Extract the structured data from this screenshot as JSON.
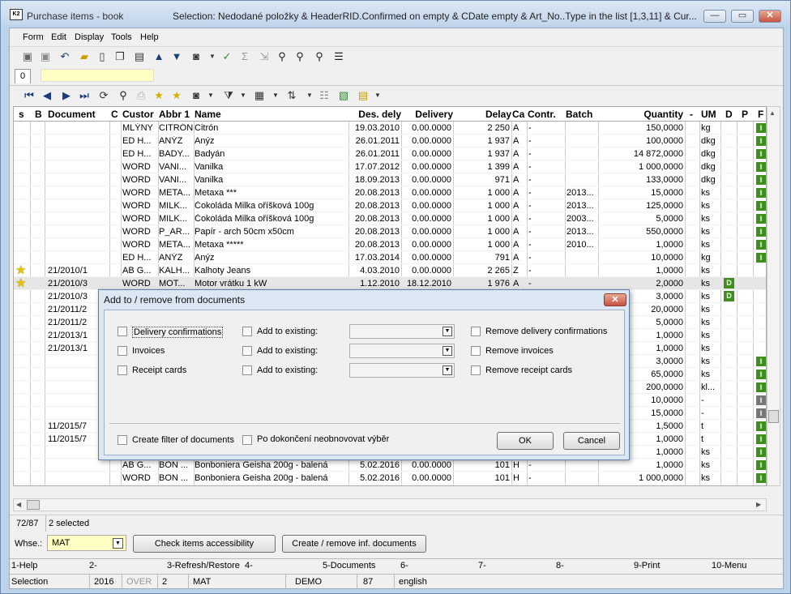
{
  "window": {
    "title": "Purchase items - book",
    "selection": "Selection: Nedodané položky & HeaderRID.Confirmed on empty  & CDate empty  & Art_No..Type in the list [1,3,11] & Cur..."
  },
  "menu": [
    "Form",
    "Edit",
    "Display",
    "Tools",
    "Help"
  ],
  "tab": {
    "label": "0"
  },
  "columns": [
    "s",
    "B",
    "Document",
    "C",
    "Custor",
    "Abbr 1",
    "Name",
    "Des. dely",
    "Delivery",
    "Delay",
    "Ca",
    "Contr.",
    "Batch",
    "Quantity",
    "-",
    "UM",
    "D",
    "P",
    "F"
  ],
  "rows": [
    {
      "star": false,
      "document": "",
      "custor": "MLÝNY",
      "abbr": "CITRÓN",
      "name": "Citrón",
      "des": "19.03.2010",
      "delivery": "0.00.0000",
      "delay": "2 250",
      "ca": "A",
      "contr": "-",
      "batch": "",
      "qty": "150,0000",
      "um": "kg",
      "d": "",
      "f": "I",
      "fgray": false
    },
    {
      "star": false,
      "document": "",
      "custor": "ED H...",
      "abbr": "ANÝZ",
      "name": "Anýz",
      "des": "26.01.2011",
      "delivery": "0.00.0000",
      "delay": "1 937",
      "ca": "A",
      "contr": "-",
      "batch": "",
      "qty": "100,0000",
      "um": "dkg",
      "d": "",
      "f": "I",
      "fgray": false
    },
    {
      "star": false,
      "document": "",
      "custor": "ED H...",
      "abbr": "BADY...",
      "name": "Badyán",
      "des": "26.01.2011",
      "delivery": "0.00.0000",
      "delay": "1 937",
      "ca": "A",
      "contr": "-",
      "batch": "",
      "qty": "14 872,0000",
      "um": "dkg",
      "d": "",
      "f": "I",
      "fgray": false
    },
    {
      "star": false,
      "document": "",
      "custor": "WORD",
      "abbr": "VANI...",
      "name": "Vanilka",
      "des": "17.07.2012",
      "delivery": "0.00.0000",
      "delay": "1 399",
      "ca": "A",
      "contr": "-",
      "batch": "",
      "qty": "1 000,0000",
      "um": "dkg",
      "d": "",
      "f": "I",
      "fgray": false
    },
    {
      "star": false,
      "document": "",
      "custor": "WORD",
      "abbr": "VANI...",
      "name": "Vanilka",
      "des": "18.09.2013",
      "delivery": "0.00.0000",
      "delay": "971",
      "ca": "A",
      "contr": "-",
      "batch": "",
      "qty": "133,0000",
      "um": "dkg",
      "d": "",
      "f": "I",
      "fgray": false
    },
    {
      "star": false,
      "document": "",
      "custor": "WORD",
      "abbr": "META...",
      "name": "Metaxa ***",
      "des": "20.08.2013",
      "delivery": "0.00.0000",
      "delay": "1 000",
      "ca": "A",
      "contr": "-",
      "batch": "2013...",
      "qty": "15,0000",
      "um": "ks",
      "d": "",
      "f": "I",
      "fgray": false
    },
    {
      "star": false,
      "document": "",
      "custor": "WORD",
      "abbr": "MILK...",
      "name": "Čokoláda Milka oříšková 100g",
      "des": "20.08.2013",
      "delivery": "0.00.0000",
      "delay": "1 000",
      "ca": "A",
      "contr": "-",
      "batch": "2013...",
      "qty": "125,0000",
      "um": "ks",
      "d": "",
      "f": "I",
      "fgray": false
    },
    {
      "star": false,
      "document": "",
      "custor": "WORD",
      "abbr": "MILK...",
      "name": "Čokoláda Milka oříšková 100g",
      "des": "20.08.2013",
      "delivery": "0.00.0000",
      "delay": "1 000",
      "ca": "A",
      "contr": "-",
      "batch": "2003...",
      "qty": "5,0000",
      "um": "ks",
      "d": "",
      "f": "I",
      "fgray": false
    },
    {
      "star": false,
      "document": "",
      "custor": "WORD",
      "abbr": "P_AR...",
      "name": "Papír - arch 50cm x50cm",
      "des": "20.08.2013",
      "delivery": "0.00.0000",
      "delay": "1 000",
      "ca": "A",
      "contr": "-",
      "batch": "2013...",
      "qty": "550,0000",
      "um": "ks",
      "d": "",
      "f": "I",
      "fgray": false
    },
    {
      "star": false,
      "document": "",
      "custor": "WORD",
      "abbr": "META...",
      "name": "Metaxa *****",
      "des": "20.08.2013",
      "delivery": "0.00.0000",
      "delay": "1 000",
      "ca": "A",
      "contr": "-",
      "batch": "2010...",
      "qty": "1,0000",
      "um": "ks",
      "d": "",
      "f": "I",
      "fgray": false
    },
    {
      "star": false,
      "document": "",
      "custor": "ED H...",
      "abbr": "ANÝZ",
      "name": "Anýz",
      "des": "17.03.2014",
      "delivery": "0.00.0000",
      "delay": "791",
      "ca": "A",
      "contr": "-",
      "batch": "",
      "qty": "10,0000",
      "um": "kg",
      "d": "",
      "f": "I",
      "fgray": false
    },
    {
      "star": true,
      "document": "21/2010/1",
      "custor": "AB G...",
      "abbr": "KALH...",
      "name": "Kalhoty Jeans",
      "des": "4.03.2010",
      "delivery": "0.00.0000",
      "delay": "2 265",
      "ca": "Z",
      "contr": "-",
      "batch": "",
      "qty": "1,0000",
      "um": "ks",
      "d": "",
      "f": "",
      "fgray": false
    },
    {
      "star": true,
      "document": "21/2010/3",
      "custor": "WORD",
      "abbr": "MOT...",
      "name": "Motor vrátku 1 kW",
      "des": "1.12.2010",
      "delivery": "18.12.2010",
      "delay": "1 976",
      "ca": "A",
      "contr": "-",
      "batch": "",
      "qty": "2,0000",
      "um": "ks",
      "d": "D",
      "f": "",
      "fgray": false,
      "sel": true
    },
    {
      "star": false,
      "document": "21/2010/3",
      "custor": "",
      "abbr": "",
      "name": "",
      "des": "",
      "delivery": "",
      "delay": "",
      "ca": "",
      "contr": "",
      "batch": "",
      "qty": "3,0000",
      "um": "ks",
      "d": "D",
      "f": "",
      "fgray": false
    },
    {
      "star": false,
      "document": "21/2011/2",
      "custor": "",
      "abbr": "",
      "name": "",
      "des": "",
      "delivery": "",
      "delay": "",
      "ca": "",
      "contr": "",
      "batch": "",
      "qty": "20,0000",
      "um": "ks",
      "d": "",
      "f": "",
      "fgray": false
    },
    {
      "star": false,
      "document": "21/2011/2",
      "custor": "",
      "abbr": "",
      "name": "",
      "des": "",
      "delivery": "",
      "delay": "",
      "ca": "",
      "contr": "",
      "batch": "",
      "qty": "5,0000",
      "um": "ks",
      "d": "",
      "f": "",
      "fgray": false
    },
    {
      "star": false,
      "document": "21/2013/1",
      "custor": "",
      "abbr": "",
      "name": "",
      "des": "",
      "delivery": "",
      "delay": "",
      "ca": "",
      "contr": "",
      "batch": "",
      "qty": "1,0000",
      "um": "ks",
      "d": "",
      "f": "",
      "fgray": false
    },
    {
      "star": false,
      "document": "21/2013/1",
      "custor": "",
      "abbr": "",
      "name": "",
      "des": "",
      "delivery": "",
      "delay": "",
      "ca": "",
      "contr": "",
      "batch": "",
      "qty": "1,0000",
      "um": "ks",
      "d": "",
      "f": "",
      "fgray": false
    },
    {
      "star": false,
      "document": "",
      "custor": "",
      "abbr": "",
      "name": "",
      "des": "",
      "delivery": "",
      "delay": "",
      "ca": "",
      "contr": "",
      "batch": "",
      "qty": "3,0000",
      "um": "ks",
      "d": "",
      "f": "I",
      "fgray": false
    },
    {
      "star": false,
      "document": "",
      "custor": "",
      "abbr": "",
      "name": "",
      "des": "",
      "delivery": "",
      "delay": "",
      "ca": "",
      "contr": "",
      "batch": "",
      "qty": "65,0000",
      "um": "ks",
      "d": "",
      "f": "I",
      "fgray": false
    },
    {
      "star": false,
      "document": "",
      "custor": "",
      "abbr": "",
      "name": "",
      "des": "",
      "delivery": "",
      "delay": "",
      "ca": "",
      "contr": "",
      "batch": "",
      "qty": "200,0000",
      "um": "kl...",
      "d": "",
      "f": "I",
      "fgray": false
    },
    {
      "star": false,
      "document": "",
      "custor": "",
      "abbr": "",
      "name": "",
      "des": "",
      "delivery": "",
      "delay": "",
      "ca": "",
      "contr": "",
      "batch": "",
      "qty": "10,0000",
      "um": "-",
      "d": "",
      "f": "I",
      "fgray": true
    },
    {
      "star": false,
      "document": "",
      "custor": "",
      "abbr": "",
      "name": "",
      "des": "",
      "delivery": "",
      "delay": "",
      "ca": "",
      "contr": "",
      "batch": "",
      "qty": "15,0000",
      "um": "-",
      "d": "",
      "f": "I",
      "fgray": true
    },
    {
      "star": false,
      "document": "11/2015/7",
      "custor": "",
      "abbr": "",
      "name": "",
      "des": "",
      "delivery": "",
      "delay": "",
      "ca": "",
      "contr": "",
      "batch": "",
      "qty": "1,5000",
      "um": "t",
      "d": "",
      "f": "I",
      "fgray": false
    },
    {
      "star": false,
      "document": "11/2015/7",
      "custor": "",
      "abbr": "",
      "name": "",
      "des": "",
      "delivery": "",
      "delay": "",
      "ca": "",
      "contr": "",
      "batch": "",
      "qty": "1,0000",
      "um": "t",
      "d": "",
      "f": "I",
      "fgray": false
    },
    {
      "star": false,
      "document": "",
      "custor": "",
      "abbr": "",
      "name": "",
      "des": "",
      "delivery": "",
      "delay": "",
      "ca": "",
      "contr": "",
      "batch": "",
      "qty": "1,0000",
      "um": "ks",
      "d": "",
      "f": "I",
      "fgray": false
    },
    {
      "star": false,
      "document": "",
      "custor": "AB G...",
      "abbr": "BON ...",
      "name": "Bonboniera Geisha 200g - balená",
      "des": "5.02.2016",
      "delivery": "0.00.0000",
      "delay": "101",
      "ca": "H",
      "contr": "-",
      "batch": "",
      "qty": "1,0000",
      "um": "ks",
      "d": "",
      "f": "I",
      "fgray": false
    },
    {
      "star": false,
      "document": "",
      "custor": "WORD",
      "abbr": "BON ...",
      "name": "Bonboniera Geisha 200g - balená",
      "des": "5.02.2016",
      "delivery": "0.00.0000",
      "delay": "101",
      "ca": "H",
      "contr": "-",
      "batch": "",
      "qty": "1 000,0000",
      "um": "ks",
      "d": "",
      "f": "I",
      "fgray": false
    }
  ],
  "status_count": "72/87",
  "status_selected": "2 selected",
  "whse": {
    "label": "Whse.:",
    "value": "MAT",
    "btn_check": "Check items accessibility",
    "btn_create": "Create / remove inf. documents"
  },
  "fkeys": [
    "1-Help",
    "2-",
    "3-Refresh/Restore",
    "4-",
    "5-Documents",
    "6-",
    "7-",
    "8-",
    "9-Print",
    "10-Menu"
  ],
  "statusbar": [
    "Selection",
    "2016",
    "OVER",
    "2",
    "MAT",
    "DEMO",
    "87",
    "english"
  ],
  "dialog": {
    "title": "Add to / remove from documents",
    "close": "✕",
    "rows": [
      {
        "label": "Delivery confirmations",
        "add": "Add to existing:",
        "remove": "Remove delivery confirmations"
      },
      {
        "label": "Invoices",
        "add": "Add to existing:",
        "remove": "Remove invoices"
      },
      {
        "label": "Receipt cards",
        "add": "Add to existing:",
        "remove": "Remove receipt cards"
      }
    ],
    "filter": "Create filter of documents",
    "norefresh": "Po dokončení neobnovovat výběr",
    "ok": "OK",
    "cancel": "Cancel"
  }
}
